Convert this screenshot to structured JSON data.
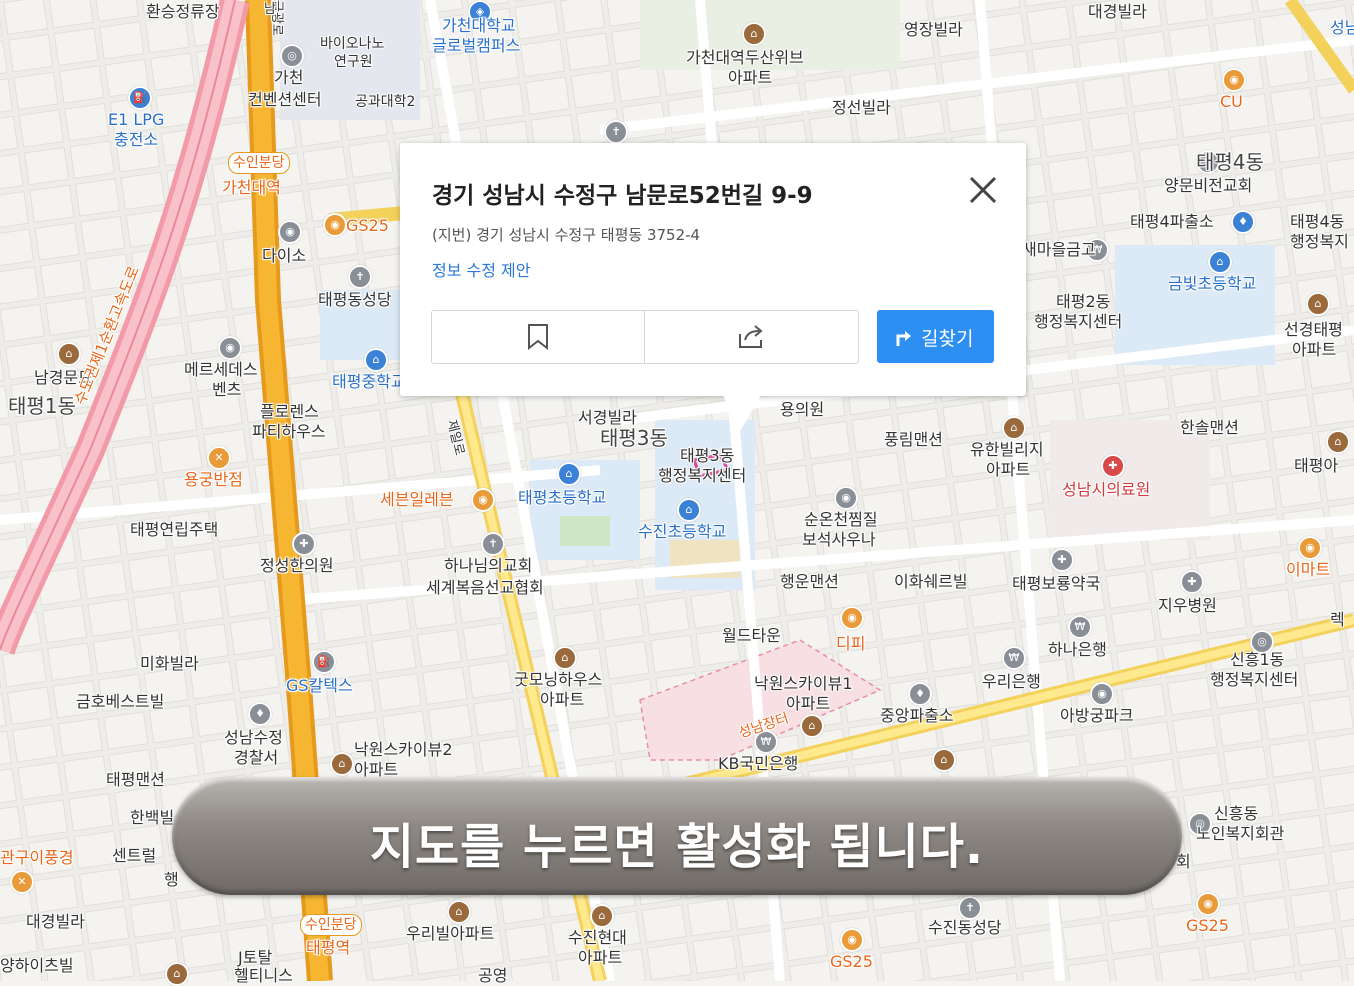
{
  "popup": {
    "title": "경기 성남시 수정구 남문로52번길 9-9",
    "jibun": "(지번) 경기 성남시 수정구 태평동 3752-4",
    "edit_link": "정보 수정 제안",
    "route_button": "길찾기"
  },
  "banner": {
    "text": "지도를 누르면 활성화 됩니다."
  },
  "map_labels": [
    "환승정류장",
    "가천대학교",
    "글로벌캠퍼스",
    "가천대역두산위브",
    "아파트",
    "영장빌라",
    "대경빌라",
    "바이오나노",
    "연구원",
    "가천",
    "컨벤션센터",
    "공과대학2",
    "정선빌라",
    "E1 LPG",
    "충전소",
    "수인분당",
    "가천대역",
    "GS25",
    "다이소",
    "태평동성당",
    "CU",
    "태평4동",
    "양문비전교회",
    "태평4파출소",
    "태평4동",
    "행정복지",
    "새마을금고",
    "태평2동",
    "행정복지센터",
    "금빛초등학교",
    "선경태평",
    "아파트",
    "남경문묘",
    "태평1동",
    "메르세데스",
    "벤츠",
    "태평중학교",
    "플로렌스",
    "파티하우스",
    "수도권제1순환고속도로",
    "서경빌라",
    "태평3동",
    "태평3동",
    "행정복지센터",
    "용의원",
    "풍림맨션",
    "유한빌리지",
    "아파트",
    "한솔맨션",
    "성남시의료원",
    "태평아",
    "용궁반점",
    "세븐일레븐",
    "태평초등학교",
    "수진초등학교",
    "순온천찜질",
    "보석사우나",
    "태평연립주택",
    "정성한의원",
    "하나님의교회",
    "세계복음선교협회",
    "행운맨션",
    "이화쉐르빌",
    "태평보룡약국",
    "지우병원",
    "이마트",
    "월드타운",
    "디피",
    "하나은행",
    "신흥1동",
    "행정복지센터",
    "미화빌라",
    "GS칼텍스",
    "굿모닝하우스",
    "아파트",
    "낙원스카이뷰1",
    "아파트",
    "우리은행",
    "중앙파출소",
    "아방궁파크",
    "금호베스트빌",
    "성남수정",
    "경찰서",
    "낙원스카이뷰2",
    "아파트",
    "KB국민은행",
    "성남장터",
    "태평맨션",
    "한백빌",
    "센트럴",
    "행",
    "신흥동",
    "노인복지회관",
    "회",
    "관구이풍경",
    "대경빌라",
    "우리빌아파트",
    "수진현대",
    "아파트",
    "수진동성당",
    "GS25",
    "GS25",
    "양하이츠빌",
    "J토탈",
    "헬티니스",
    "수인분당",
    "태평역",
    "공영",
    "렉",
    "성남",
    "제일로",
    "금광로",
    "남"
  ]
}
